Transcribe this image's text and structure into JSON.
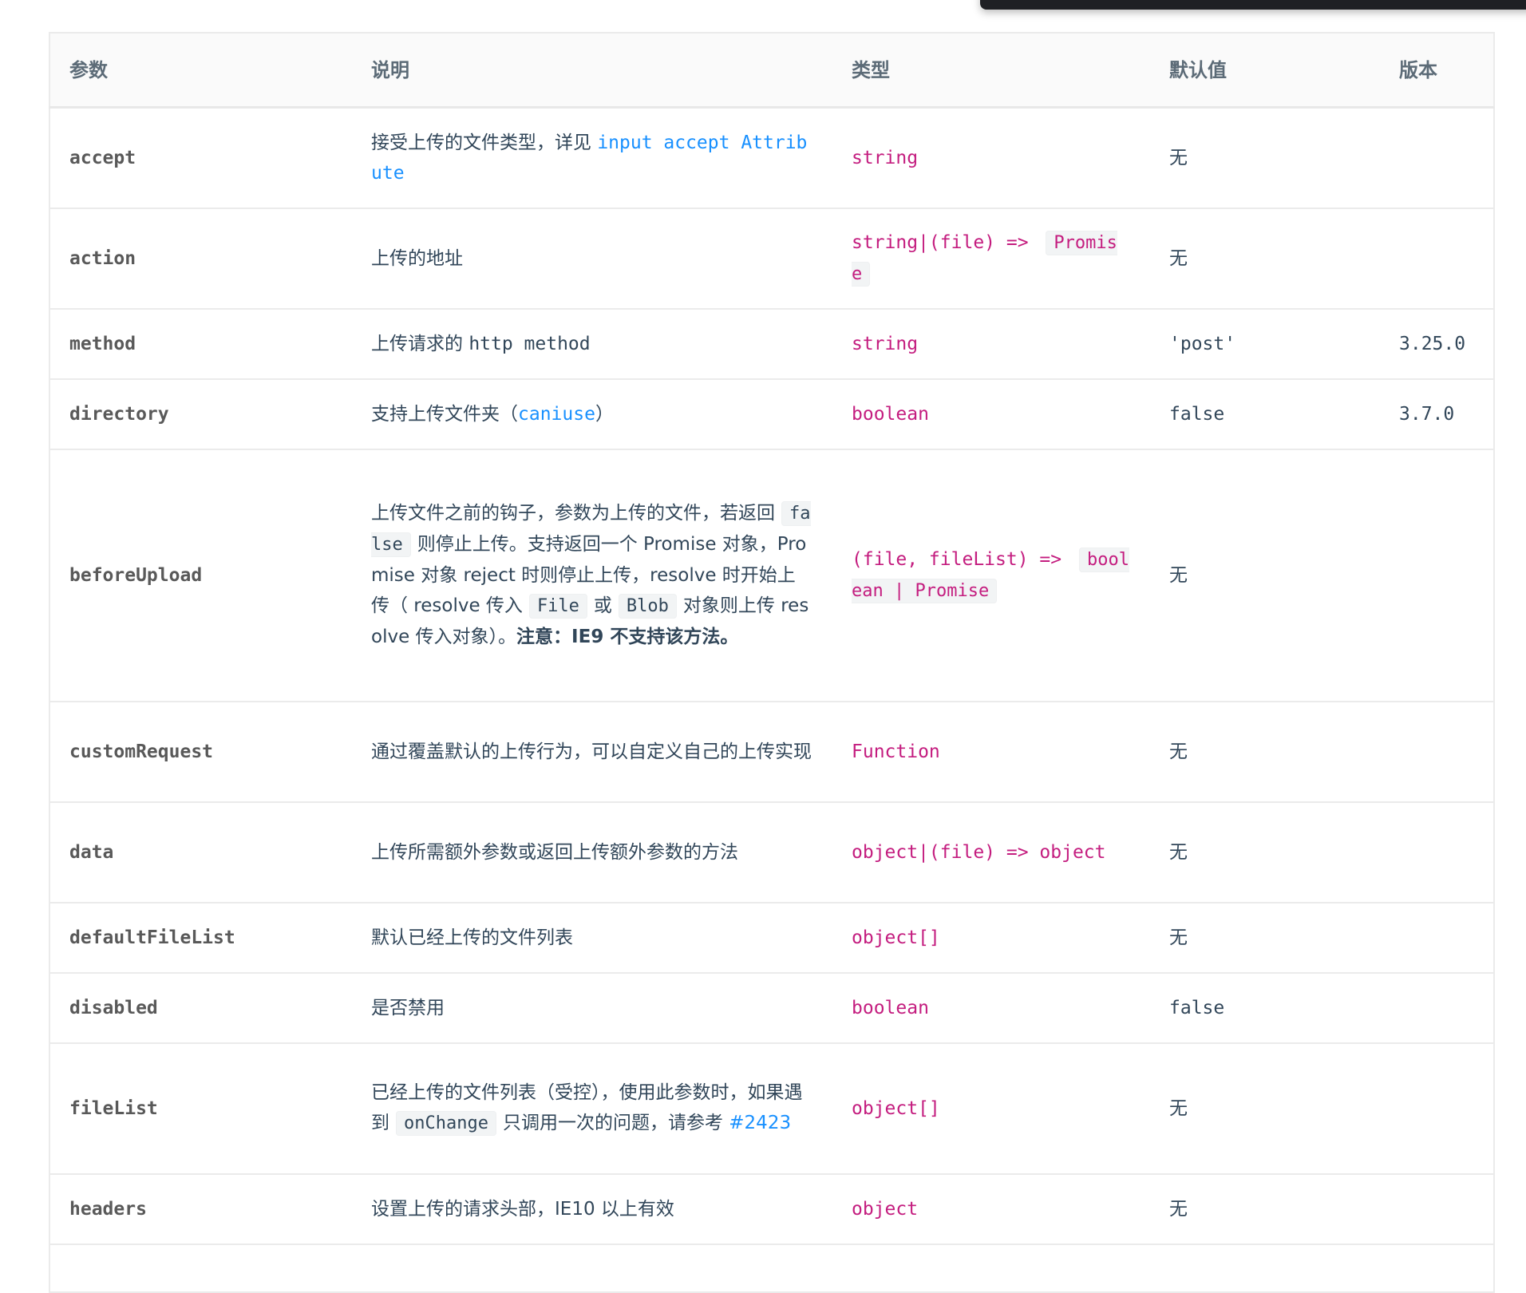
{
  "table": {
    "headers": [
      "参数",
      "说明",
      "类型",
      "默认值",
      "版本"
    ],
    "rows": [
      {
        "name": "accept",
        "desc_text": "接受上传的文件类型，详见 ",
        "desc_link": "input accept Attribute",
        "type": "string",
        "default": "无",
        "version": ""
      },
      {
        "name": "action",
        "desc_text": "上传的地址",
        "type_text": "string|(file) => ",
        "type_code": "Promise",
        "default": "无",
        "version": ""
      },
      {
        "name": "method",
        "desc_text": "上传请求的 ",
        "desc_mono": "http method",
        "type": "string",
        "default": "'post'",
        "version": "3.25.0"
      },
      {
        "name": "directory",
        "desc_text": "支持上传文件夹（",
        "desc_link": "caniuse",
        "desc_after": "）",
        "type": "boolean",
        "default": "false",
        "version": "3.7.0"
      },
      {
        "name": "beforeUpload",
        "desc_p1": "上传文件之前的钩子，参数为上传的文件，若返回",
        "desc_code1": "false",
        "desc_p2": "则停止上传。支持返回一个 Promise 对象，Promise 对象 reject 时则停止上传，resolve 时开始上传（ resolve 传入",
        "desc_code2": "File",
        "desc_p3": "或",
        "desc_code3": "Blob",
        "desc_p4": "对象则上传 resolve 传入对象）。",
        "desc_bold": "注意：IE9 不支持该方法。",
        "type_text": "(file, fileList) => ",
        "type_code": "boolean | Promise",
        "default": "无",
        "version": ""
      },
      {
        "name": "customRequest",
        "desc_text": "通过覆盖默认的上传行为，可以自定义自己的上传实现",
        "type": "Function",
        "default": "无",
        "version": ""
      },
      {
        "name": "data",
        "desc_text": "上传所需额外参数或返回上传额外参数的方法",
        "type": "object|(file) => object",
        "default": "无",
        "version": ""
      },
      {
        "name": "defaultFileList",
        "desc_text": "默认已经上传的文件列表",
        "type": "object[]",
        "default": "无",
        "version": ""
      },
      {
        "name": "disabled",
        "desc_text": "是否禁用",
        "type": "boolean",
        "default": "false",
        "version": ""
      },
      {
        "name": "fileList",
        "desc_p1": "已经上传的文件列表（受控），使用此参数时，如果遇到",
        "desc_code1": "onChange",
        "desc_p2": "只调用一次的问题，请参考 ",
        "desc_link": "#2423",
        "type": "object[]",
        "default": "无",
        "version": ""
      },
      {
        "name": "headers",
        "desc_text": "设置上传的请求头部，IE10 以上有效",
        "type": "object",
        "default": "无",
        "version": ""
      }
    ]
  }
}
